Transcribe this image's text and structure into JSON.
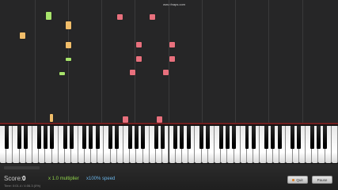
{
  "watermark": "www.fnaps.com",
  "score": {
    "label": "Score:",
    "value": "0"
  },
  "time_text": "Time: 0:01.4 / 4:06.3 (0%)",
  "multiplier": {
    "prefix": "x",
    "value": "1.0",
    "label": "multiplier"
  },
  "speed": {
    "prefix": "x",
    "value": "100%",
    "label": "speed"
  },
  "buttons": {
    "quit": "Quit",
    "pause": "Pause"
  },
  "progress_fraction": 0.0,
  "colors": {
    "green_note": "#a7e36b",
    "orange_note": "#f0bd6a",
    "pink_note": "#e8707d",
    "hit_glow": "#a02a2a",
    "multiplier_text": "#8fd24a",
    "speed_text": "#6ab4e8"
  },
  "icons": {
    "quit": "stop-square-icon"
  }
}
